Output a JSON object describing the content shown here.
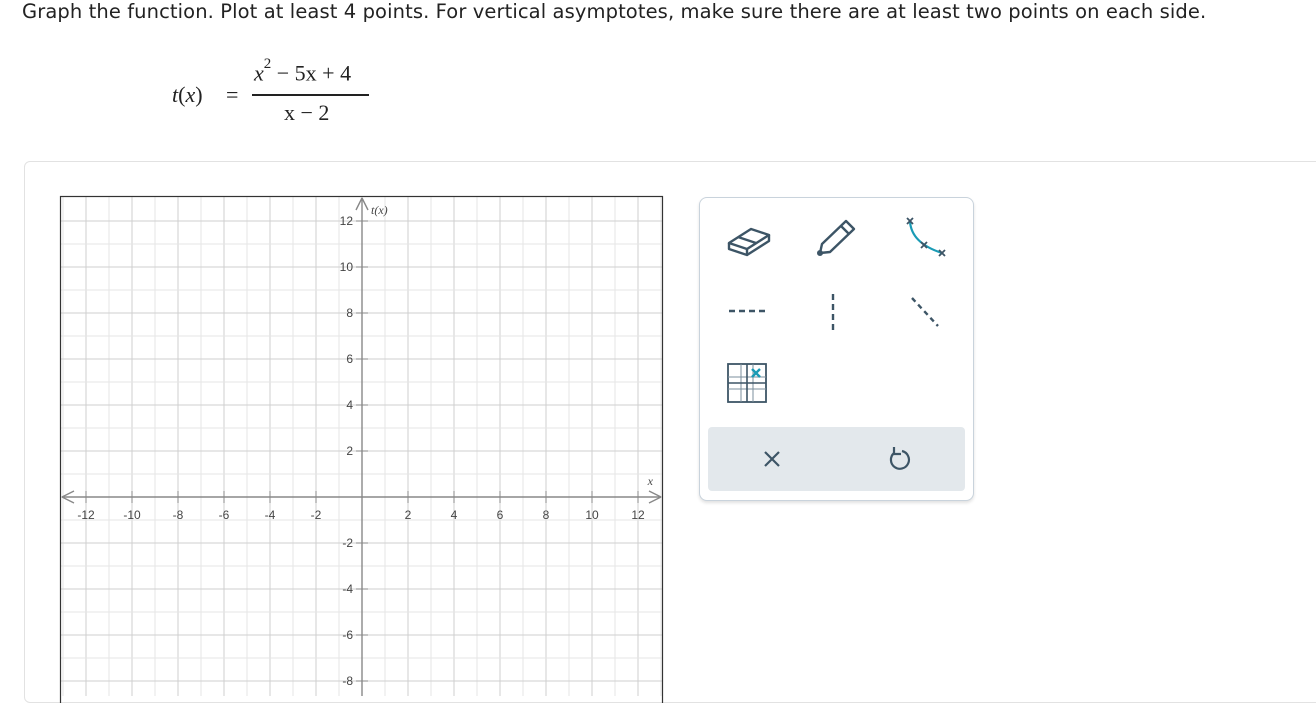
{
  "prompt": "Graph the function. Plot at least 4 points. For vertical asymptotes, make sure there are at least two points on each side.",
  "formula": {
    "lhs_name": "t",
    "lhs_var": "x",
    "equals": "=",
    "numerator": "x² − 5x + 4",
    "numerator_base": "x",
    "numerator_exp": "2",
    "numerator_rest": " − 5x + 4",
    "denominator": "x − 2"
  },
  "graph": {
    "x_axis_label": "x",
    "y_axis_label": "t(x)",
    "x_ticks": [
      "-12",
      "-10",
      "-8",
      "-6",
      "-4",
      "-2",
      "2",
      "4",
      "6",
      "8",
      "10",
      "12"
    ],
    "y_ticks": [
      "12",
      "10",
      "8",
      "6",
      "4",
      "2",
      "-2",
      "-4",
      "-6",
      "-8"
    ],
    "x_range": [
      -13,
      13
    ],
    "y_range": [
      -8.5,
      12.5
    ],
    "grid": true,
    "colors": {
      "grid": "#d6d6d6",
      "axis": "#888888",
      "frame": "#333333",
      "label": "#444444"
    }
  },
  "tools": {
    "eraser": "eraser-icon",
    "pencil": "pencil-icon",
    "curve": "curve-through-points-icon",
    "horizontal_dashed": "horizontal-asymptote-icon",
    "vertical_dashed": "vertical-asymptote-icon",
    "diagonal_dashed": "slant-asymptote-icon",
    "point": "point-on-grid-icon",
    "clear": "clear-x-icon",
    "undo": "undo-icon",
    "accent": "#1a9bb5",
    "icon_color": "#3d5566"
  }
}
